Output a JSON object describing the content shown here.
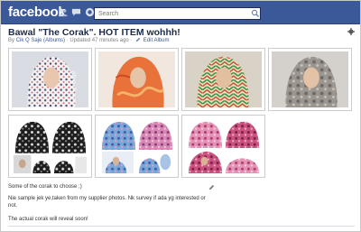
{
  "brand": {
    "logo": "facebook",
    "color": "#3b5998"
  },
  "search": {
    "placeholder": "Search"
  },
  "nav_icons": [
    "friend-requests-icon",
    "messages-icon",
    "notifications-icon"
  ],
  "album": {
    "title": "Bawal \"The Corak\". HOT ITEM wohhh!",
    "by_prefix": "By",
    "owner": "Cik Q Saje (Albums)",
    "updated": "· Updated 47 minutes ago ·",
    "edit_label": "Edit Album"
  },
  "photos": [
    {
      "name": "photo-1",
      "alt": "Mannequin in white floral patterned scarf"
    },
    {
      "name": "photo-2",
      "alt": "Mannequin in orange patterned scarf"
    },
    {
      "name": "photo-3",
      "alt": "Mannequin in colorful chevron scarf"
    },
    {
      "name": "photo-4",
      "alt": "Mannequin in gray floral scarf"
    },
    {
      "name": "photo-5",
      "alt": "Collage of black and white printed scarves"
    },
    {
      "name": "photo-6",
      "alt": "Collage of blue and pink printed scarves"
    },
    {
      "name": "photo-7",
      "alt": "Collage of pink floral scarves"
    }
  ],
  "watermark": "Cik Q Saje",
  "captions": [
    "Some of the corak to choose ;)",
    "Nie sample jek ye,taken from my supplier photos. Nk survey if ada yg interested or",
    "not.",
    "The actual corak will reveal soon!"
  ]
}
